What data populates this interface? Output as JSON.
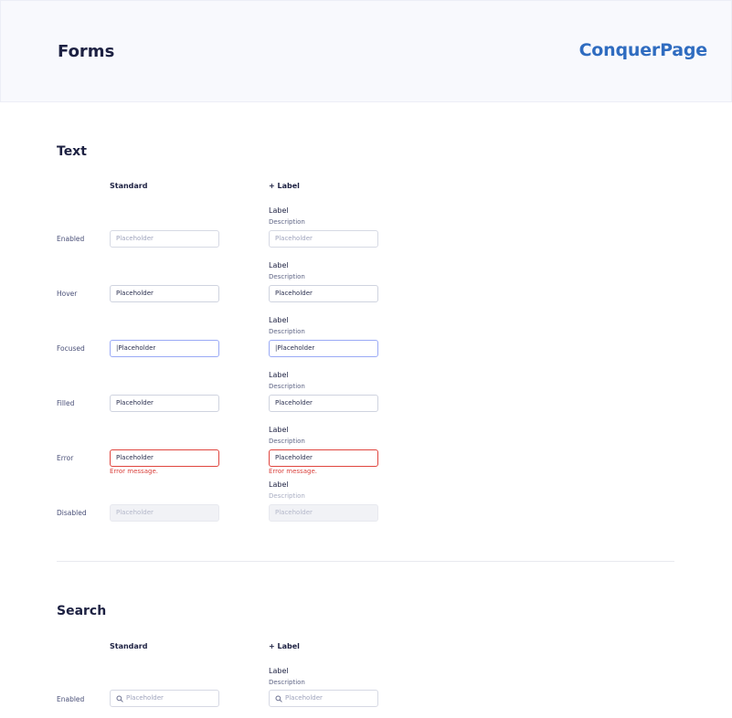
{
  "header": {
    "title": "Forms",
    "brand": "ConquerPage"
  },
  "text_section": {
    "title": "Text",
    "columns": {
      "standard": "Standard",
      "with_label": "+ Label"
    },
    "rows": {
      "enabled": "Enabled",
      "hover": "Hover",
      "focused": "Focused",
      "filled": "Filled",
      "error": "Error",
      "disabled": "Disabled"
    },
    "field_label": "Label",
    "field_description": "Description",
    "placeholder": "Placeholder",
    "focused_value": "|Placeholder",
    "error_message": "Error message."
  },
  "search_section": {
    "title": "Search",
    "columns": {
      "standard": "Standard",
      "with_label": "+ Label"
    },
    "rows": {
      "enabled": "Enabled"
    },
    "field_label": "Label",
    "field_description": "Description",
    "placeholder": "Placeholder",
    "icon": "search-icon"
  },
  "colors": {
    "brand": "#2f6cc0",
    "focus_border": "#9aaaf5",
    "error": "#d9423d",
    "header_bg": "#f8f9fd"
  }
}
